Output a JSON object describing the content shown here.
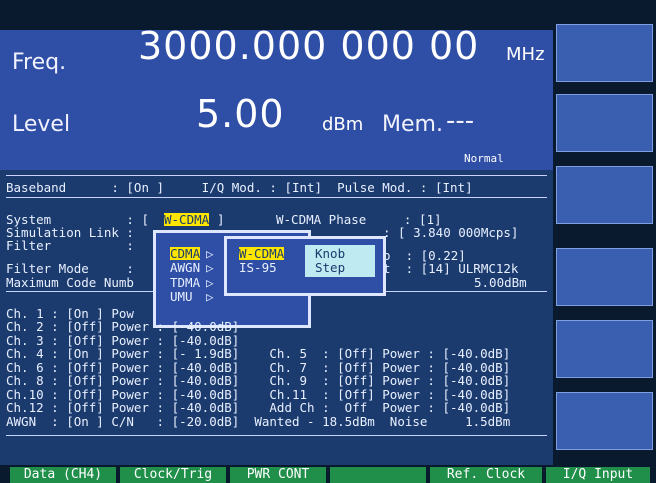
{
  "header": {
    "freq_label": "Freq.",
    "freq_value": "3000.000 000 00",
    "freq_unit": "MHz",
    "level_label": "Level",
    "level_value": "5.00",
    "level_unit": "dBm",
    "mem_label": "Mem.",
    "mem_value": "---",
    "mode": "Normal"
  },
  "status_line": "Baseband      : [On ]     I/Q Mod. : [Int]  Pulse Mod. : [Int]",
  "params": {
    "system_label": "System          : [",
    "system_value": "W-CDMA",
    "system_close": "]",
    "phase": "W-CDMA Phase     : [1]",
    "sim_link": "Simulation Link :",
    "chip_rate": ": [ 3.840 000Mcps]",
    "filter": "Filter          :",
    "roll_off": "o  : [0.22]",
    "filter_mode": "Filter Mode     :",
    "meas": "t  : [14] ULRMC12k",
    "max_code": "Maximum Code Numb",
    "max_code_val": "5.00dBm"
  },
  "popup1": {
    "items": [
      "CDMA",
      "AWGN",
      "TDMA",
      "UMU"
    ],
    "arrow": "▷"
  },
  "popup2": {
    "items": [
      "W-CDMA",
      "IS-95"
    ],
    "knob": "Knob",
    "step": "Step"
  },
  "channels": [
    "Ch. 1 : [On ] Pow",
    "Ch. 2 : [Off] Power : [-40.0dB]",
    "Ch. 3 : [Off] Power : [-40.0dB]",
    "Ch. 4 : [On ] Power : [- 1.9dB]    Ch. 5  : [Off] Power : [-40.0dB]",
    "Ch. 6 : [Off] Power : [-40.0dB]    Ch. 7  : [Off] Power : [-40.0dB]",
    "Ch. 8 : [Off] Power : [-40.0dB]    Ch. 9  : [Off] Power : [-40.0dB]",
    "Ch.10 : [Off] Power : [-40.0dB]    Ch.11  : [Off] Power : [-40.0dB]",
    "Ch.12 : [Off] Power : [-40.0dB]    Add Ch :  Off  Power : [-40.0dB]",
    "AWGN  : [On ] C/N   : [-20.0dB]  Wanted - 18.5dBm  Noise     1.5dBm"
  ],
  "bottom_keys": [
    "Data (CH4)",
    "Clock/Trig",
    "PWR CONT",
    "",
    "Ref. Clock",
    "I/Q Input"
  ],
  "colors": {
    "screen_bg": "#1b3a6e",
    "header_bg": "#2f4ea6",
    "highlight_yellow": "#ffe600",
    "highlight_cyan": "#bfeaf2",
    "softkey_green": "#1f8f4a"
  }
}
